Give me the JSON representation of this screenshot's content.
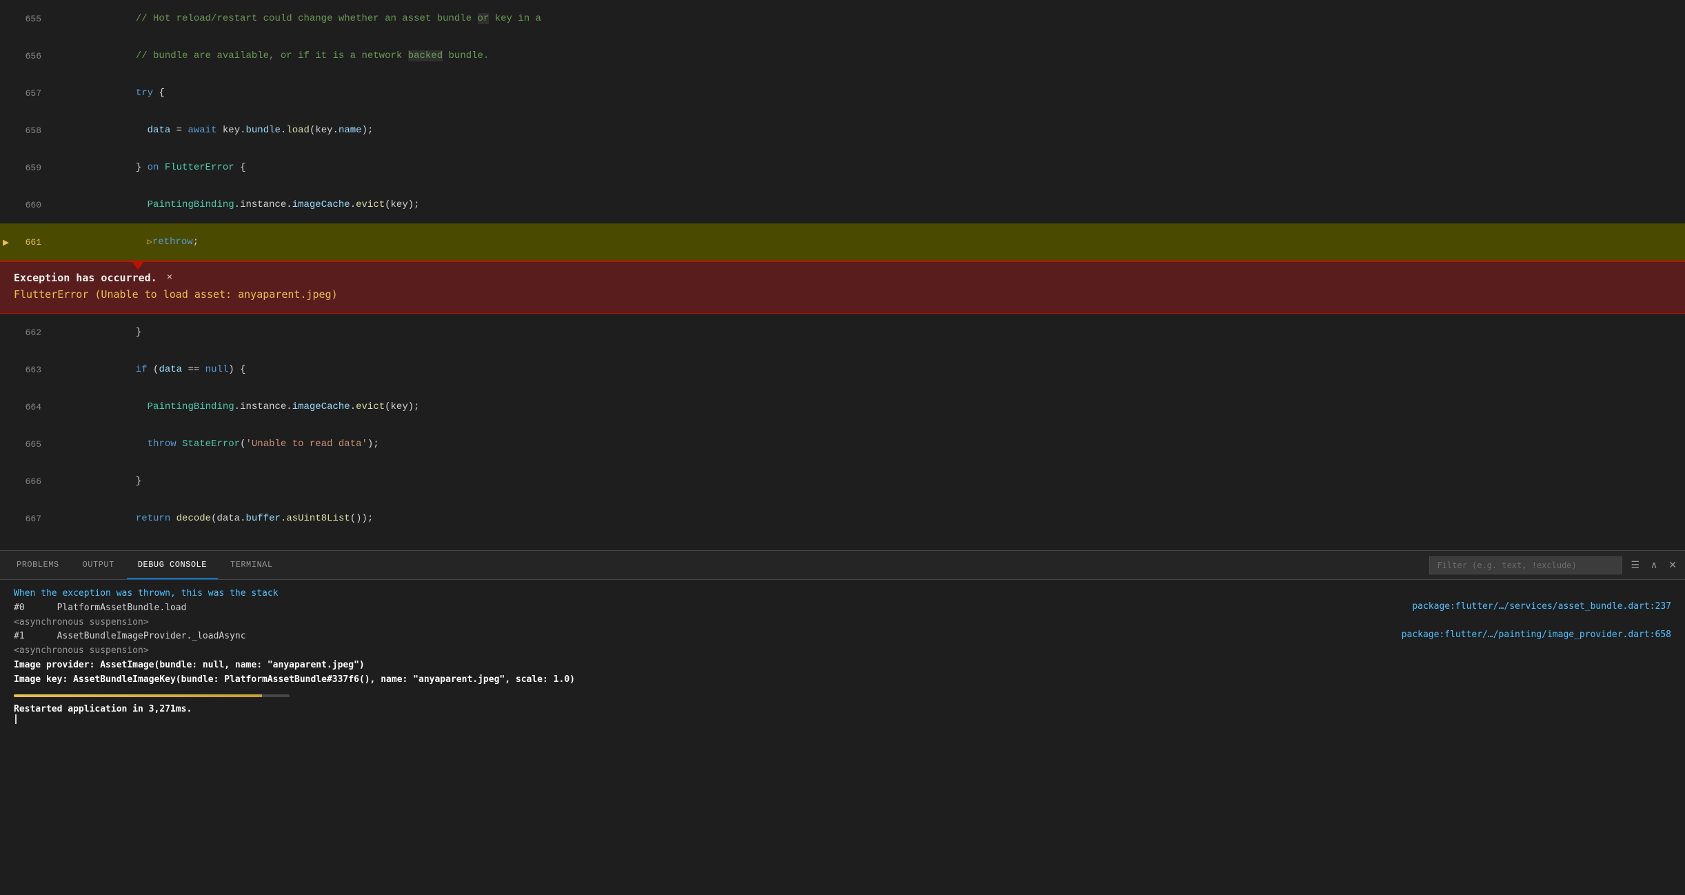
{
  "editor": {
    "lines": [
      {
        "number": "655",
        "tokens": [
          {
            "text": "    // Hot reload/restart could change whether an asset bundle ",
            "class": "cmt"
          },
          {
            "text": "or",
            "class": "cmt"
          },
          {
            "text": " key in a",
            "class": "cmt"
          }
        ],
        "highlighted": false,
        "debug_arrow": false
      },
      {
        "number": "656",
        "tokens": [
          {
            "text": "    // bundle are available, ",
            "class": "cmt"
          },
          {
            "text": "or",
            "class": "cmt"
          },
          {
            "text": " if it is a network ",
            "class": "cmt"
          },
          {
            "text": "backed",
            "class": "cmt"
          },
          {
            "text": " bundle.",
            "class": "cmt"
          }
        ],
        "highlighted": false,
        "debug_arrow": false
      },
      {
        "number": "657",
        "tokens": [
          {
            "text": "    ",
            "class": "plain"
          },
          {
            "text": "try",
            "class": "kw"
          },
          {
            "text": " {",
            "class": "plain"
          }
        ],
        "highlighted": false,
        "debug_arrow": false
      },
      {
        "number": "658",
        "tokens": [
          {
            "text": "      ",
            "class": "plain"
          },
          {
            "text": "data",
            "class": "var"
          },
          {
            "text": " = ",
            "class": "plain"
          },
          {
            "text": "await",
            "class": "kw"
          },
          {
            "text": " key.",
            "class": "plain"
          },
          {
            "text": "bundle",
            "class": "var"
          },
          {
            "text": ".",
            "class": "plain"
          },
          {
            "text": "load",
            "class": "fn"
          },
          {
            "text": "(key.",
            "class": "plain"
          },
          {
            "text": "name",
            "class": "var"
          },
          {
            "text": ");",
            "class": "plain"
          }
        ],
        "highlighted": false,
        "debug_arrow": false
      },
      {
        "number": "659",
        "tokens": [
          {
            "text": "    } ",
            "class": "plain"
          },
          {
            "text": "on",
            "class": "kw"
          },
          {
            "text": " ",
            "class": "plain"
          },
          {
            "text": "FlutterError",
            "class": "cls"
          },
          {
            "text": " {",
            "class": "plain"
          }
        ],
        "highlighted": false,
        "debug_arrow": false
      },
      {
        "number": "660",
        "tokens": [
          {
            "text": "      ",
            "class": "plain"
          },
          {
            "text": "PaintingBinding",
            "class": "cls"
          },
          {
            "text": ".instance.",
            "class": "plain"
          },
          {
            "text": "imageCache",
            "class": "var"
          },
          {
            "text": ".",
            "class": "plain"
          },
          {
            "text": "evict",
            "class": "fn"
          },
          {
            "text": "(key);",
            "class": "plain"
          }
        ],
        "highlighted": false,
        "debug_arrow": false
      },
      {
        "number": "661",
        "tokens": [
          {
            "text": "      ",
            "class": "plain"
          },
          {
            "text": "▷",
            "class": "plain"
          },
          {
            "text": "rethrow",
            "class": "kw"
          },
          {
            "text": ";",
            "class": "plain"
          }
        ],
        "highlighted": true,
        "debug_arrow": true
      }
    ],
    "after_exception_lines": [
      {
        "number": "662",
        "tokens": [
          {
            "text": "    }",
            "class": "plain"
          }
        ],
        "highlighted": false
      },
      {
        "number": "663",
        "tokens": [
          {
            "text": "    ",
            "class": "plain"
          },
          {
            "text": "if",
            "class": "kw"
          },
          {
            "text": " (",
            "class": "plain"
          },
          {
            "text": "data",
            "class": "var"
          },
          {
            "text": " == ",
            "class": "plain"
          },
          {
            "text": "null",
            "class": "kw"
          },
          {
            "text": ") {",
            "class": "plain"
          }
        ],
        "highlighted": false
      },
      {
        "number": "664",
        "tokens": [
          {
            "text": "      ",
            "class": "plain"
          },
          {
            "text": "PaintingBinding",
            "class": "cls"
          },
          {
            "text": ".instance.",
            "class": "plain"
          },
          {
            "text": "imageCache",
            "class": "var"
          },
          {
            "text": ".",
            "class": "plain"
          },
          {
            "text": "evict",
            "class": "fn"
          },
          {
            "text": "(key);",
            "class": "plain"
          }
        ],
        "highlighted": false
      },
      {
        "number": "665",
        "tokens": [
          {
            "text": "      ",
            "class": "plain"
          },
          {
            "text": "throw",
            "class": "kw"
          },
          {
            "text": " ",
            "class": "plain"
          },
          {
            "text": "StateError",
            "class": "cls"
          },
          {
            "text": "(",
            "class": "plain"
          },
          {
            "text": "'Unable to read data'",
            "class": "str"
          },
          {
            "text": ");",
            "class": "plain"
          }
        ],
        "highlighted": false
      },
      {
        "number": "666",
        "tokens": [
          {
            "text": "    }",
            "class": "plain"
          }
        ],
        "highlighted": false
      },
      {
        "number": "667",
        "tokens": [
          {
            "text": "    ",
            "class": "plain"
          },
          {
            "text": "return",
            "class": "kw"
          },
          {
            "text": " ",
            "class": "plain"
          },
          {
            "text": "decode",
            "class": "fn"
          },
          {
            "text": "(data.",
            "class": "plain"
          },
          {
            "text": "buffer",
            "class": "var"
          },
          {
            "text": ".",
            "class": "plain"
          },
          {
            "text": "asUint8List",
            "class": "fn"
          },
          {
            "text": "());",
            "class": "plain"
          }
        ],
        "highlighted": false
      }
    ]
  },
  "exception": {
    "title": "Exception has occurred.",
    "close_label": "×",
    "message": "FlutterError (Unable to load asset: anyaparent.jpeg)"
  },
  "bottom_panel": {
    "tabs": [
      "PROBLEMS",
      "OUTPUT",
      "DEBUG CONSOLE",
      "TERMINAL"
    ],
    "active_tab": "DEBUG CONSOLE",
    "filter_placeholder": "Filter (e.g. text, !exclude)",
    "console_lines": [
      {
        "text": "When the exception was thrown, this was the stack",
        "class": "cyan",
        "right": ""
      },
      {
        "text": "#0      PlatformAssetBundle.load",
        "class": "plain",
        "right": "package:flutter/…/services/asset_bundle.dart:237"
      },
      {
        "text": "<asynchronous suspension>",
        "class": "gray",
        "right": ""
      },
      {
        "text": "#1      AssetBundleImageProvider._loadAsync",
        "class": "plain",
        "right": "package:flutter/…/painting/image_provider.dart:658"
      },
      {
        "text": "<asynchronous suspension>",
        "class": "gray",
        "right": ""
      },
      {
        "text": "Image provider: AssetImage(bundle: null, name: \"anyaparent.jpeg\")",
        "class": "white-bold",
        "right": ""
      },
      {
        "text": "Image key: AssetBundleImageKey(bundle: PlatformAssetBundle#337f6(), name: \"anyaparent.jpeg\", scale: 1.0)",
        "class": "white-bold",
        "right": ""
      },
      {
        "text": "",
        "class": "plain",
        "right": ""
      },
      {
        "text": "Restarted application in 3,271ms.",
        "class": "restarted",
        "right": ""
      },
      {
        "text": "▌",
        "class": "cursor",
        "right": ""
      }
    ]
  }
}
